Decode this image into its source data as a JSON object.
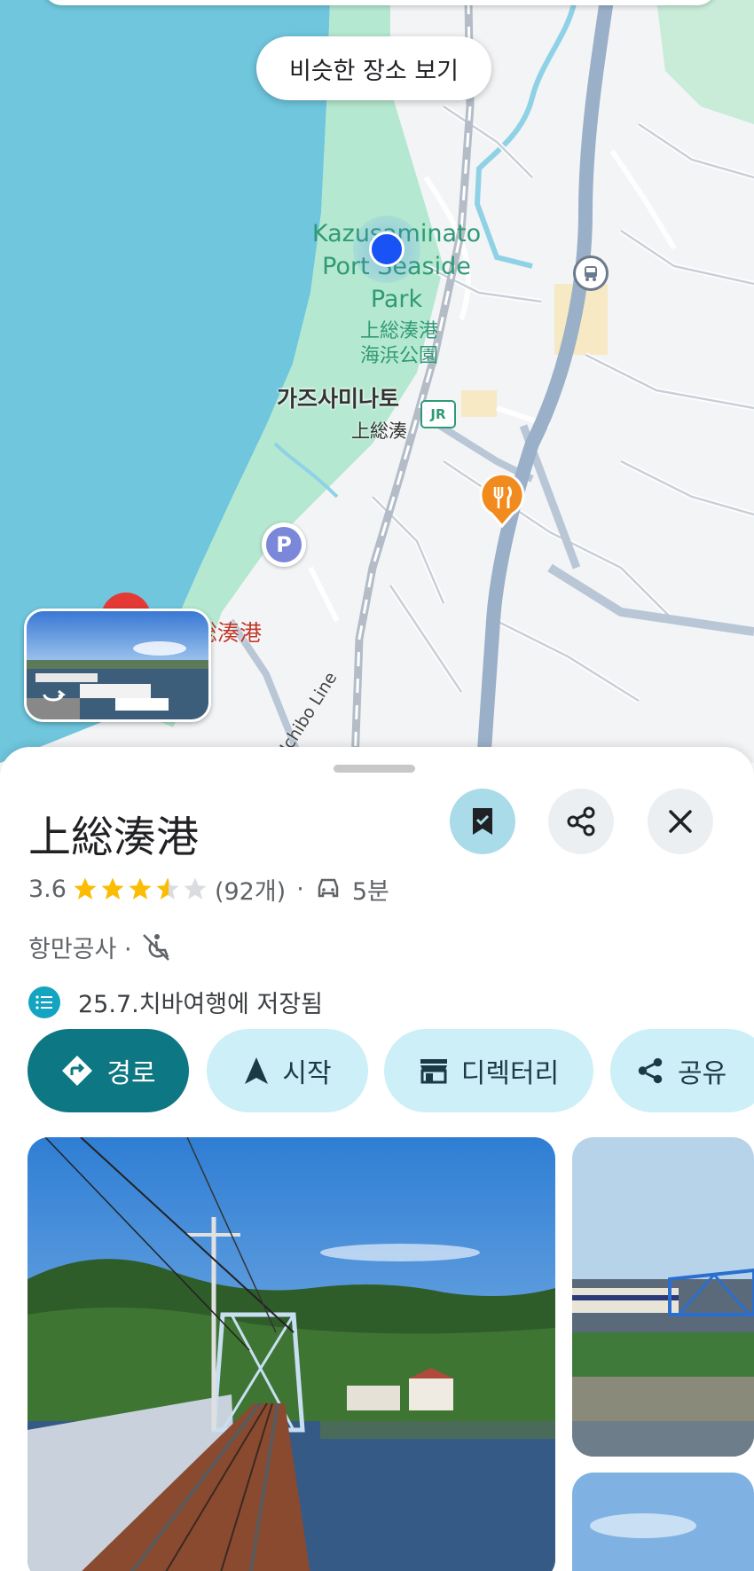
{
  "map": {
    "similar_places_label": "비슷한 장소 보기",
    "park_label_en_line1": "Kazusaminato",
    "park_label_en_line2": "Port Seaside",
    "park_label_en_line3": "Park",
    "park_label_jp_line1": "上総湊港",
    "park_label_jp_line2": "海浜公園",
    "station_label": "가즈사미나토",
    "station_label_jp": "上総湊",
    "port_label": "総湊港",
    "rail_line_label": "Uchibo Line",
    "icons": [
      "bus-stop-icon",
      "jr-station-icon",
      "restaurant-icon",
      "parking-icon",
      "current-location-icon",
      "place-pin-icon",
      "streetview-icon"
    ]
  },
  "place": {
    "title": "上総湊港",
    "rating": "3.6",
    "rating_value": 3.6,
    "review_count": "(92개)",
    "separator": "·",
    "drive_time": "5분",
    "category": "항만공사 ·",
    "saved_list": "25.7.치바여행에 저장됨"
  },
  "actions": [
    {
      "label": "경로",
      "icon": "directions-icon"
    },
    {
      "label": "시작",
      "icon": "navigation-icon"
    },
    {
      "label": "디렉터리",
      "icon": "store-icon"
    },
    {
      "label": "공유",
      "icon": "share-icon"
    }
  ],
  "colors": {
    "primary": "#0d7783",
    "chip_bg": "#cdeff7",
    "star": "#fbbc04",
    "water": "#6fc6dd",
    "park": "#b5e8d1",
    "road": "#9ab0c8"
  }
}
